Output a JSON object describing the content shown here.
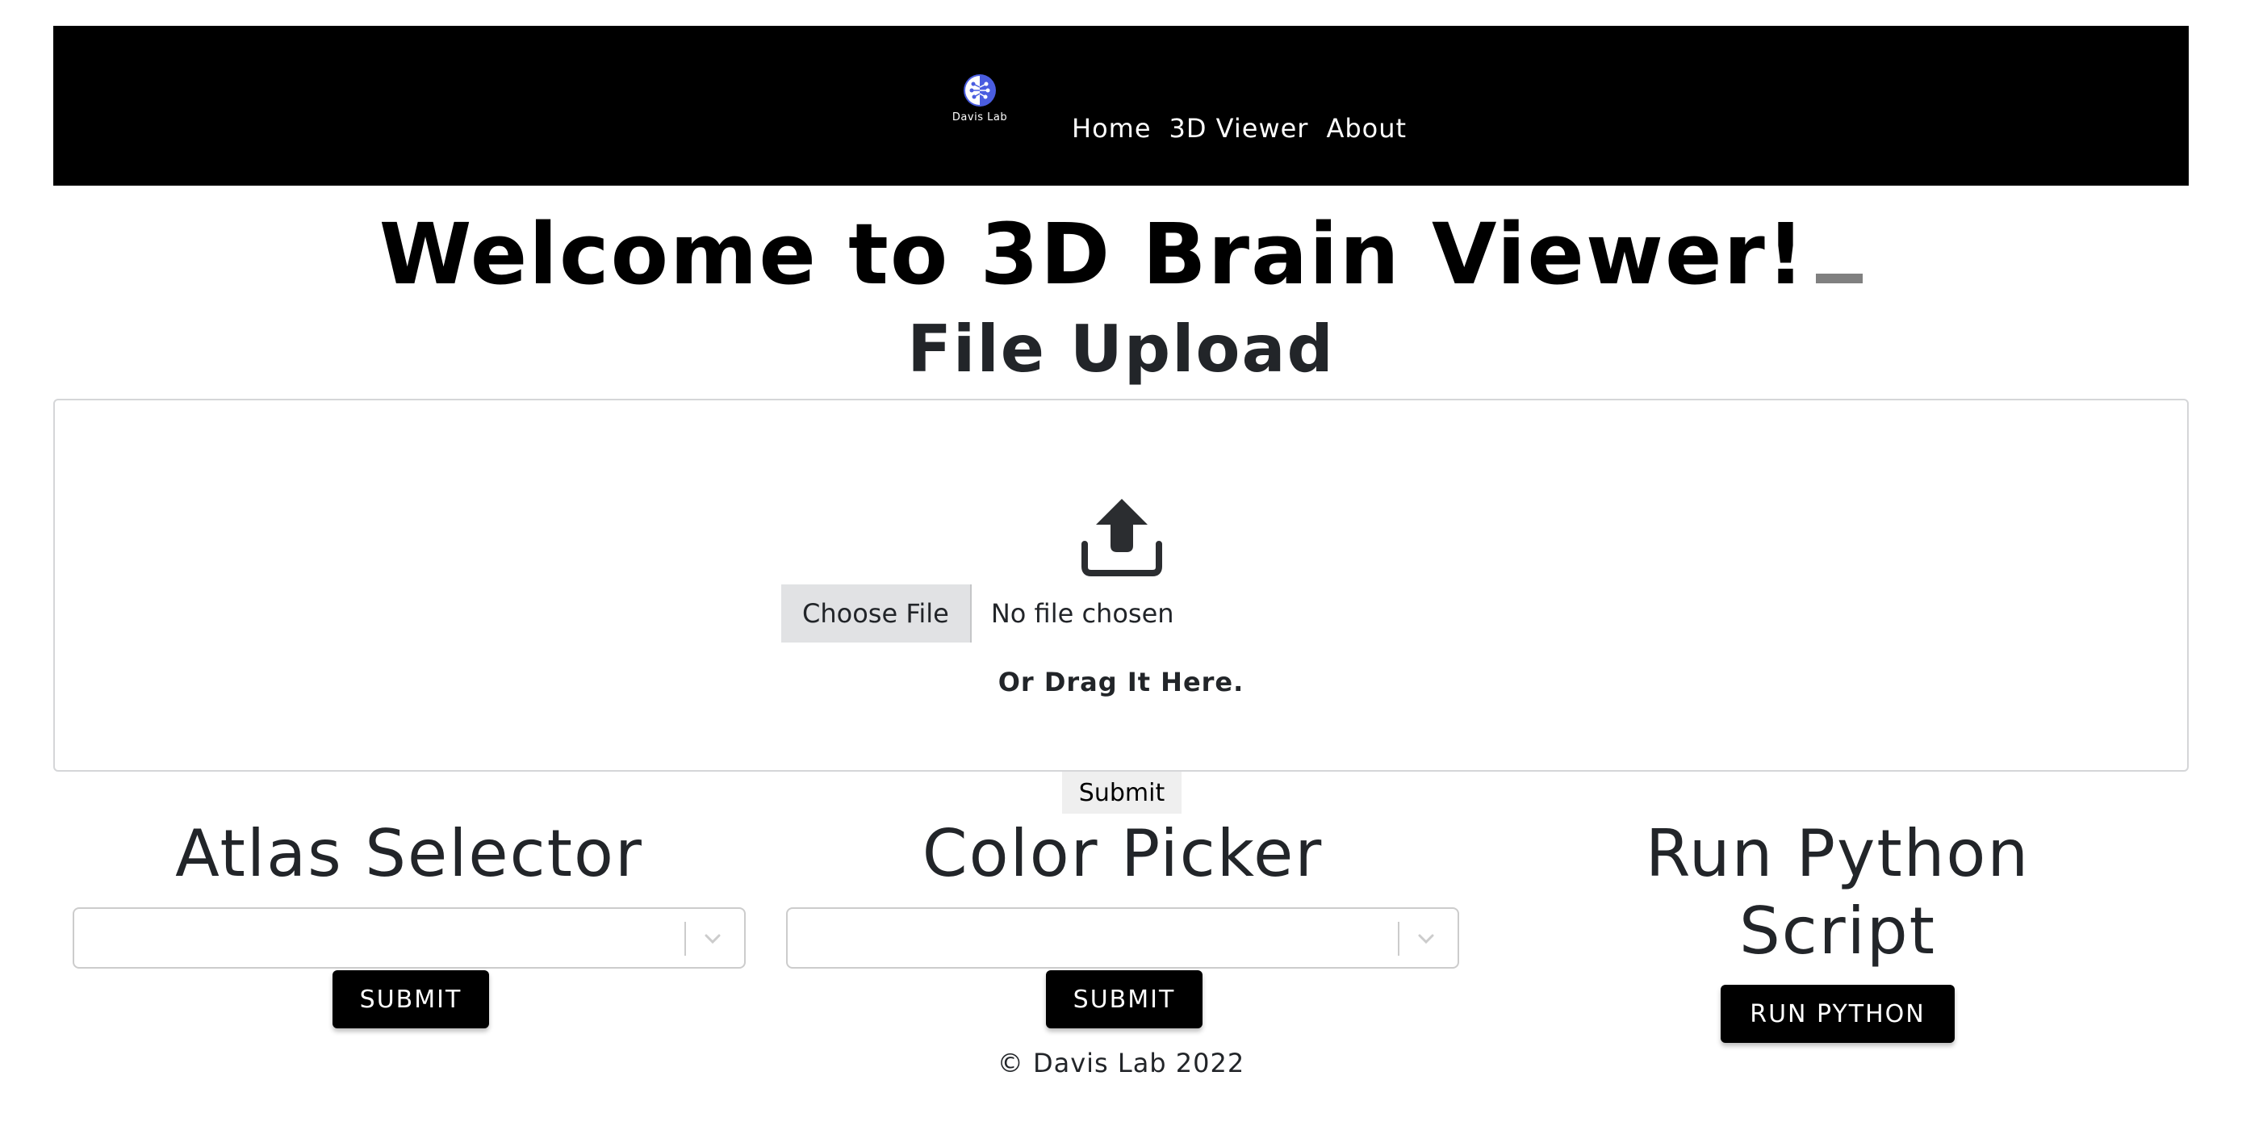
{
  "navbar": {
    "brand_text": "Davis Lab",
    "links": [
      {
        "label": "Home"
      },
      {
        "label": "3D Viewer"
      },
      {
        "label": "About"
      }
    ],
    "background": "#000000"
  },
  "main": {
    "welcome_title": "Welcome to 3D Brain Viewer!",
    "upload_heading": "File Upload",
    "upload": {
      "icon": "upload-icon",
      "choose_file_label": "Choose File",
      "file_status": "No file chosen",
      "drag_text": "Or Drag It Here.",
      "submit_label": "Submit"
    }
  },
  "atlas": {
    "heading": "Atlas Selector",
    "select_value": "",
    "submit_label": "SUBMIT"
  },
  "color": {
    "heading": "Color Picker",
    "select_value": "",
    "submit_label": "SUBMIT"
  },
  "python": {
    "heading_line1": "Run Python",
    "heading_line2": "Script",
    "button_label": "RUN PYTHON"
  },
  "footer": {
    "text": "© Davis Lab 2022"
  },
  "colors": {
    "nav_bg": "#000000",
    "brand_accent": "#4a5de0",
    "button_bg": "#000000",
    "button_text": "#ffffff",
    "heading_text": "#222529"
  }
}
